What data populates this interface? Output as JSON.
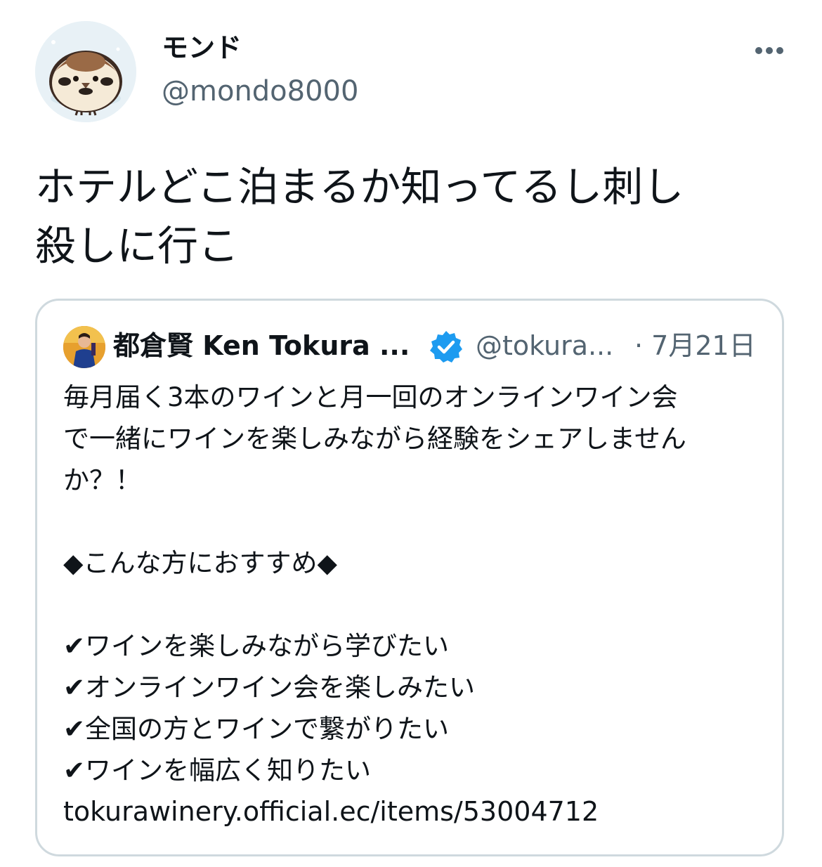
{
  "tweet": {
    "author": {
      "display_name": "モンド",
      "handle": "@mondo8000",
      "avatar_icon": "sparrow-avatar-icon"
    },
    "more_icon": "more-horizontal-icon",
    "text": "ホテルどこ泊まるか知ってるし刺し\n殺しに行こ"
  },
  "quoted_tweet": {
    "author": {
      "display_name": "都倉賢 Ken Tokura ...",
      "handle": "@tokura...",
      "verified_icon": "verified-badge-icon",
      "avatar_icon": "profile-photo-icon"
    },
    "date": "· 7月21日",
    "lines": [
      "毎月届く3本のワインと月一回のオンラインワイン会",
      "で一緒にワインを楽しみながら経験をシェアしません",
      "か？！",
      "",
      "◆こんな方におすすめ◆",
      "",
      "✔ワインを楽しみながら学びたい",
      "✔オンラインワイン会を楽しみたい",
      "✔全国の方とワインで繋がりたい",
      "✔ワインを幅広く知りたい"
    ],
    "link": "tokurawinery.official.ec/items/53004712"
  },
  "colors": {
    "text_primary": "#0f1419",
    "text_secondary": "#536471",
    "card_border": "#cfd9de",
    "verified_blue": "#1d9bf0"
  }
}
